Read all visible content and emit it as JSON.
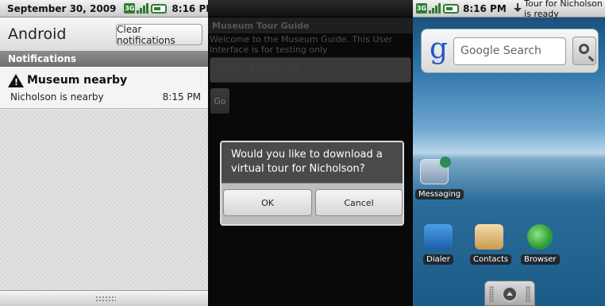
{
  "colors": {
    "status_green": "#2e7d32",
    "wallpaper_sky": "#2c74a8",
    "notif_header": "#7d7d7d"
  },
  "panel_notifications": {
    "statusbar": {
      "date": "September 30, 2009",
      "time": "8:16 PM",
      "icons": [
        "3g-icon",
        "signal-icon",
        "battery-icon"
      ]
    },
    "header_title": "Android",
    "clear_button": "Clear notifications",
    "section_title": "Notifications",
    "notification": {
      "icon": "warning-icon",
      "title": "Museum nearby",
      "text": "Nicholson is nearby",
      "time": "8:15 PM"
    }
  },
  "panel_app": {
    "title": "Museum Tour Guide",
    "welcome": "Welcome to the Museum Guide. This User Interface is for testing only",
    "article_placeholder": "Enter Article ID",
    "go_button": "Go",
    "dialog": {
      "message": "Would you like to download a virtual tour for Nicholson?",
      "ok": "OK",
      "cancel": "Cancel"
    }
  },
  "panel_home": {
    "statusbar": {
      "time": "8:16 PM",
      "notification_text": "Tour for Nicholson is ready"
    },
    "search_placeholder": "Google Search",
    "google_letter": "g",
    "apps": [
      {
        "label": "Messaging",
        "icon": "messaging-icon"
      },
      {
        "label": "Dialer",
        "icon": "dialer-icon"
      },
      {
        "label": "Contacts",
        "icon": "contacts-icon"
      },
      {
        "label": "Browser",
        "icon": "browser-icon"
      }
    ]
  }
}
